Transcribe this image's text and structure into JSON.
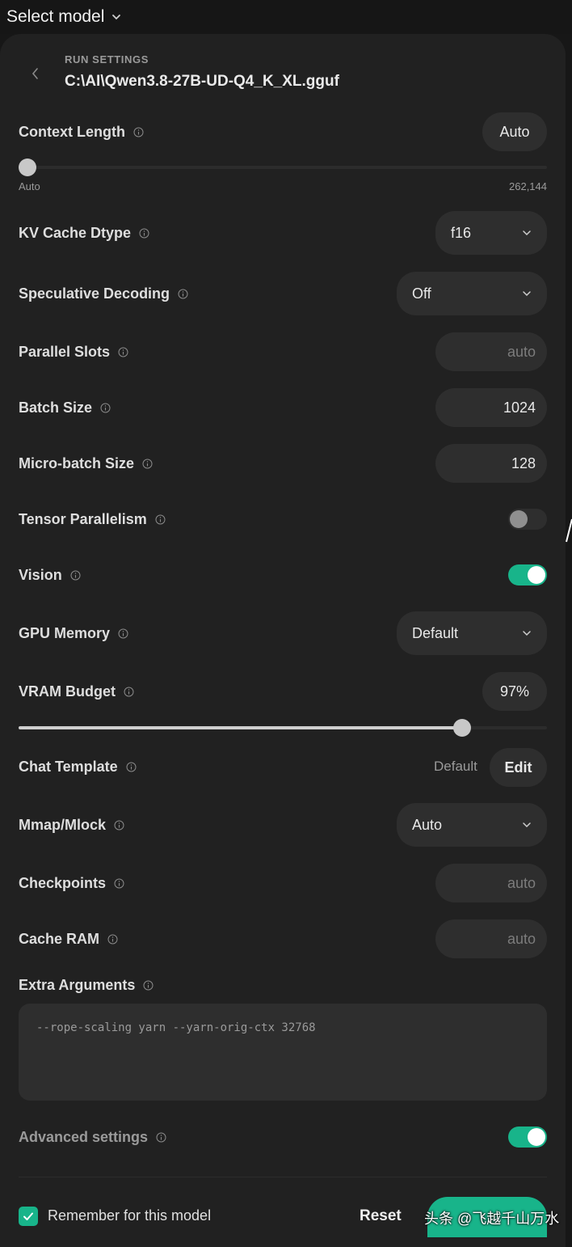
{
  "topbar": {
    "title": "Select model"
  },
  "header": {
    "section_label": "RUN SETTINGS",
    "model_path": "C:\\AI\\Qwen3.8-27B-UD-Q4_K_XL.gguf"
  },
  "settings": {
    "context_length": {
      "label": "Context Length",
      "value": "Auto",
      "min_label": "Auto",
      "max_label": "262,144",
      "slider_fraction": 0.0
    },
    "kv_cache_dtype": {
      "label": "KV Cache Dtype",
      "value": "f16"
    },
    "speculative_decoding": {
      "label": "Speculative Decoding",
      "value": "Off"
    },
    "parallel_slots": {
      "label": "Parallel Slots",
      "placeholder": "auto"
    },
    "batch_size": {
      "label": "Batch Size",
      "value": "1024"
    },
    "micro_batch_size": {
      "label": "Micro-batch Size",
      "value": "128"
    },
    "tensor_parallelism": {
      "label": "Tensor Parallelism",
      "enabled": false
    },
    "vision": {
      "label": "Vision",
      "enabled": true
    },
    "gpu_memory": {
      "label": "GPU Memory",
      "value": "Default"
    },
    "vram_budget": {
      "label": "VRAM Budget",
      "value": "97%",
      "slider_fraction": 0.84
    },
    "chat_template": {
      "label": "Chat Template",
      "status": "Default",
      "edit_label": "Edit"
    },
    "mmap_mlock": {
      "label": "Mmap/Mlock",
      "value": "Auto"
    },
    "checkpoints": {
      "label": "Checkpoints",
      "placeholder": "auto"
    },
    "cache_ram": {
      "label": "Cache RAM",
      "placeholder": "auto"
    },
    "extra_arguments": {
      "label": "Extra Arguments",
      "value": "--rope-scaling yarn --yarn-orig-ctx 32768"
    },
    "advanced_settings": {
      "label": "Advanced settings",
      "enabled": true
    }
  },
  "footer": {
    "remember_label": "Remember for this model",
    "remember_checked": true,
    "reset_label": "Reset",
    "watermark": "头条 @飞越千山万水"
  },
  "colors": {
    "accent": "#18b48a",
    "panel": "#212121",
    "field": "#2e2e2e"
  }
}
